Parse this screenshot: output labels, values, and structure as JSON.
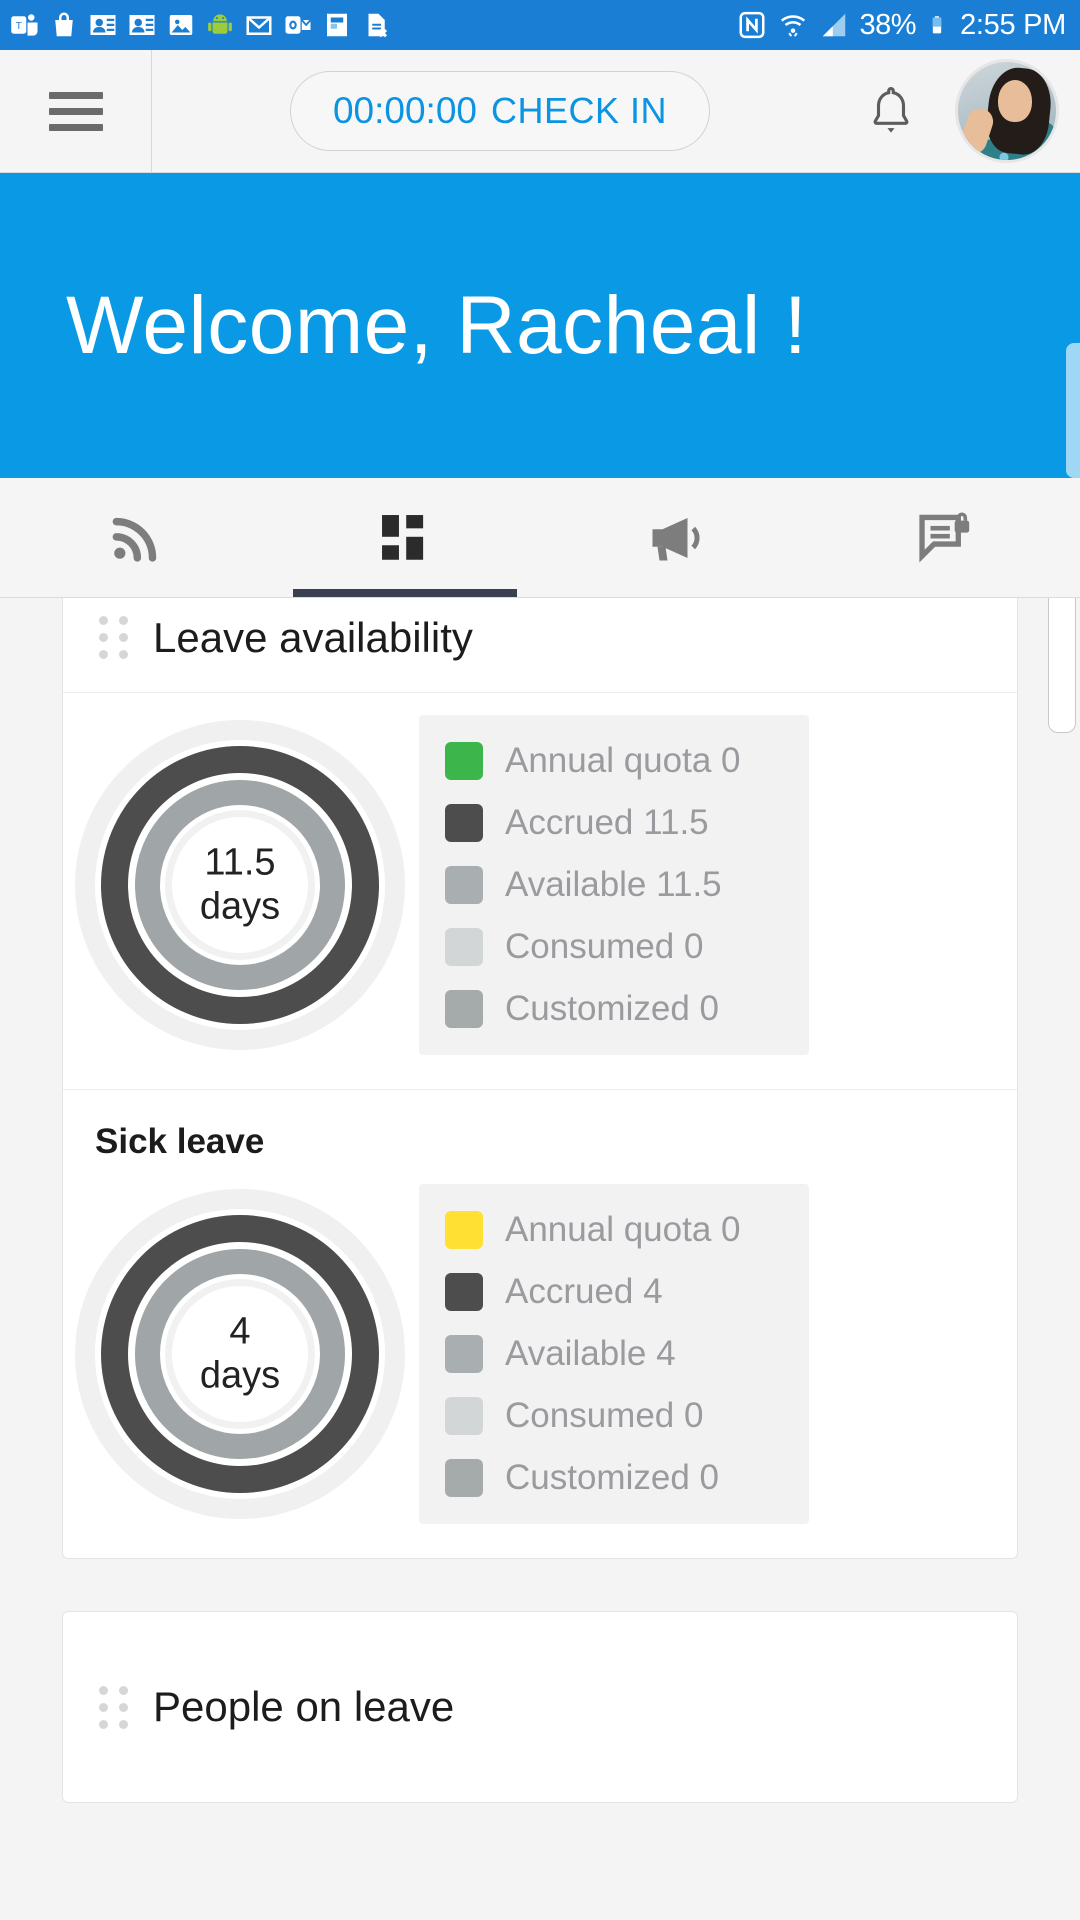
{
  "status_bar": {
    "left_icons": [
      "microsoft-teams-icon",
      "shopping-bag-icon",
      "contacts-icon",
      "contacts-alt-icon",
      "gallery-icon",
      "android-icon",
      "gmail-icon",
      "outlook-icon",
      "flipboard-icon",
      "sim-card-error-icon"
    ],
    "right_icons": [
      "nfc-icon",
      "wifi-icon",
      "signal-icon"
    ],
    "battery_percent": "38%",
    "time": "2:55 PM",
    "background_color": "#1a7fd4"
  },
  "app_bar": {
    "menu_icon": "hamburger-menu-icon",
    "check_in": {
      "timer": "00:00:00",
      "label": "CHECK IN",
      "accent_color": "#0a94e2"
    },
    "notification_icon": "bell-icon",
    "avatar": "user-avatar"
  },
  "banner": {
    "greeting": "Welcome, Racheal !",
    "background_color": "#0a9ae5",
    "text_color": "#ffffff"
  },
  "tabs": [
    {
      "name": "feed",
      "icon": "rss-feed-icon",
      "active": false
    },
    {
      "name": "dashboard",
      "icon": "dashboard-grid-icon",
      "active": true
    },
    {
      "name": "announcements",
      "icon": "megaphone-icon",
      "active": false
    },
    {
      "name": "private-messages",
      "icon": "locked-message-icon",
      "active": false
    }
  ],
  "cards": {
    "leave_availability": {
      "title": "Leave availability",
      "drag_handle": "drag-handle-icon"
    },
    "people_on_leave": {
      "title": "People on leave",
      "drag_handle": "drag-handle-icon"
    }
  },
  "chart_data": [
    {
      "type": "pie",
      "title": "Leave availability",
      "subtitle": "",
      "center_value": "11.5",
      "center_unit": "days",
      "legend_position": "right",
      "categories": [
        "Annual quota",
        "Accrued",
        "Available",
        "Consumed",
        "Customized"
      ],
      "values": [
        0,
        11.5,
        11.5,
        0,
        0
      ],
      "legend": [
        {
          "label": "Annual quota 0",
          "color": "#3cb54a",
          "name": "Annual quota",
          "value": 0
        },
        {
          "label": "Accrued 11.5",
          "color": "#4d4d4d",
          "name": "Accrued",
          "value": 11.5
        },
        {
          "label": "Available 11.5",
          "color": "#a9aeb1",
          "name": "Available",
          "value": 11.5
        },
        {
          "label": "Consumed 0",
          "color": "#d2d6d7",
          "name": "Consumed",
          "value": 0
        },
        {
          "label": "Customized 0",
          "color": "#a5aaab",
          "name": "Customized",
          "value": 0
        }
      ]
    },
    {
      "type": "pie",
      "title": "Sick leave",
      "subtitle": "",
      "center_value": "4",
      "center_unit": "days",
      "legend_position": "right",
      "categories": [
        "Annual quota",
        "Accrued",
        "Available",
        "Consumed",
        "Customized"
      ],
      "values": [
        0,
        4,
        4,
        0,
        0
      ],
      "legend": [
        {
          "label": "Annual quota 0",
          "color": "#ffe033",
          "name": "Annual quota",
          "value": 0
        },
        {
          "label": "Accrued 4",
          "color": "#4d4d4d",
          "name": "Accrued",
          "value": 4
        },
        {
          "label": "Available 4",
          "color": "#a9aeb1",
          "name": "Available",
          "value": 4
        },
        {
          "label": "Consumed 0",
          "color": "#d2d6d7",
          "name": "Consumed",
          "value": 0
        },
        {
          "label": "Customized 0",
          "color": "#a5aaab",
          "name": "Customized",
          "value": 0
        }
      ]
    }
  ]
}
